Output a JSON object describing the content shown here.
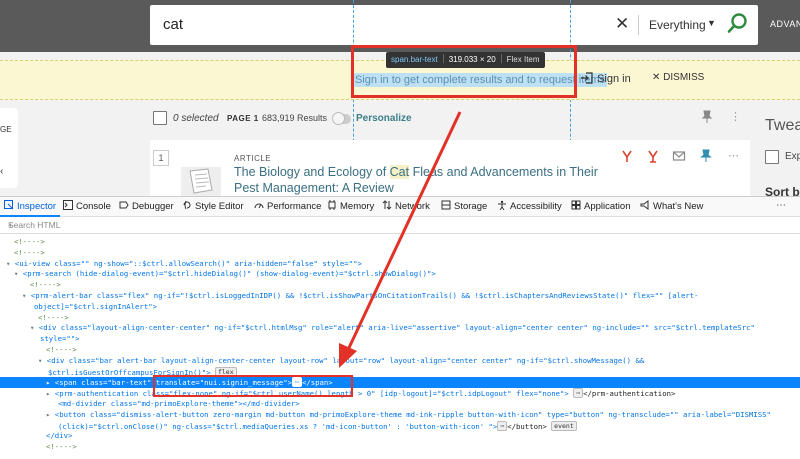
{
  "search": {
    "query": "cat",
    "scope": "Everything",
    "advanced_label": "ADVANC"
  },
  "alert": {
    "message": "Sign in to get complete results and to request items",
    "signin_label": "Sign in",
    "dismiss_label": "DISMISS"
  },
  "tooltip": {
    "selector": "span.bar-text",
    "size": "319.033 × 20",
    "kind": "Flex Item"
  },
  "left_panel": {
    "label": "GE"
  },
  "toolbar": {
    "selected": "0 selected",
    "page": "PAGE 1",
    "results": "683,919 Results",
    "personalize": "Personalize"
  },
  "result": {
    "number": "1",
    "type": "ARTICLE",
    "title_before": "The Biology and Ecology of ",
    "title_highlight": "Cat",
    "title_after": " Fleas and Advancements in Their Pest Management: A Review"
  },
  "side": {
    "title": "Tweak",
    "exp": "Exp",
    "sort": "Sort b"
  },
  "colors": {
    "search_band": "#5a5a5a",
    "alert_bg": "#fbf7d3",
    "highlight": "#bde1f2",
    "annotation_red": "#e23126",
    "devtools_selected": "#0a84ff",
    "teal_link": "#3a6f82"
  },
  "devtools": {
    "tabs": [
      {
        "label": "Inspector",
        "icon": "inspector-icon"
      },
      {
        "label": "Console",
        "icon": "console-icon"
      },
      {
        "label": "Debugger",
        "icon": "debugger-icon"
      },
      {
        "label": "Style Editor",
        "icon": "style-editor-icon"
      },
      {
        "label": "Performance",
        "icon": "performance-icon"
      },
      {
        "label": "Memory",
        "icon": "memory-icon"
      },
      {
        "label": "Network",
        "icon": "network-icon"
      },
      {
        "label": "Storage",
        "icon": "storage-icon"
      },
      {
        "label": "Accessibility",
        "icon": "accessibility-icon"
      },
      {
        "label": "Application",
        "icon": "application-icon"
      },
      {
        "label": "What's New",
        "icon": "whats-new-icon"
      }
    ],
    "search_placeholder": "Search HTML",
    "code_lines": [
      "<!---->",
      "<!---->",
      "<ui-view class=\"\" ng-show=\"::$ctrl.allowSearch()\" aria-hidden=\"false\" style=\"\">",
      "<prm-search (hide-dialog-event)=\"$ctrl.hideDialog()\" (show-dialog-event)=\"$ctrl.showDialog()\">",
      "<!---->",
      "<prm-alert-bar class=\"flex\" ng-if=\"!$ctrl.isLoggedInIDP() && !$ctrl.isShowPartsOnCitationTrails() && !$ctrl.isChaptersAndReviewsState()\" flex=\"\" [alert-",
      "object]=\"$ctrl.signInAlert\">",
      "<!---->",
      "<div class=\"layout-align-center-center\" ng-if=\"$ctrl.htmlMsg\" role=\"alert\" aria-live=\"assertive\" layout-align=\"center center\" ng-include=\"\" src=\"$ctrl.templateSrc\"",
      "style=\"\">",
      "<!---->",
      "<div class=\"bar alert-bar layout-align-center-center layout-row\" layout=\"row\" layout-align=\"center center\" ng-if=\"$ctrl.showMessage() &&",
      "$ctrl.isGuestOrOffcampusForSignIn()\">",
      "<span class=\"bar-text\" translate=\"nui.signin_message\">",
      "<prm-authentication class=\"flex-none\" ng-if=\"$ctrl.userName().length > 0\" [idp-logout]=\"$ctrl.idpLogout\" flex=\"none\">",
      "<md-divider class=\"md-primoExplore-theme\"></md-divider>",
      "<button class=\"dismiss-alert-button zero-margin md-button md-primoExplore-theme md-ink-ripple button-with-icon\" type=\"button\" ng-transclude=\"\" aria-label=\"DISMISS\"",
      "(click)=\"$ctrl.onClose()\" ng-class=\"$ctrl.mediaQueries.xs ? 'md-icon-button' : 'button-with-icon' \">",
      "</div>",
      "<!---->"
    ],
    "badges": {
      "flex": "flex",
      "event": "event",
      "ellipsis": "⋯"
    }
  }
}
